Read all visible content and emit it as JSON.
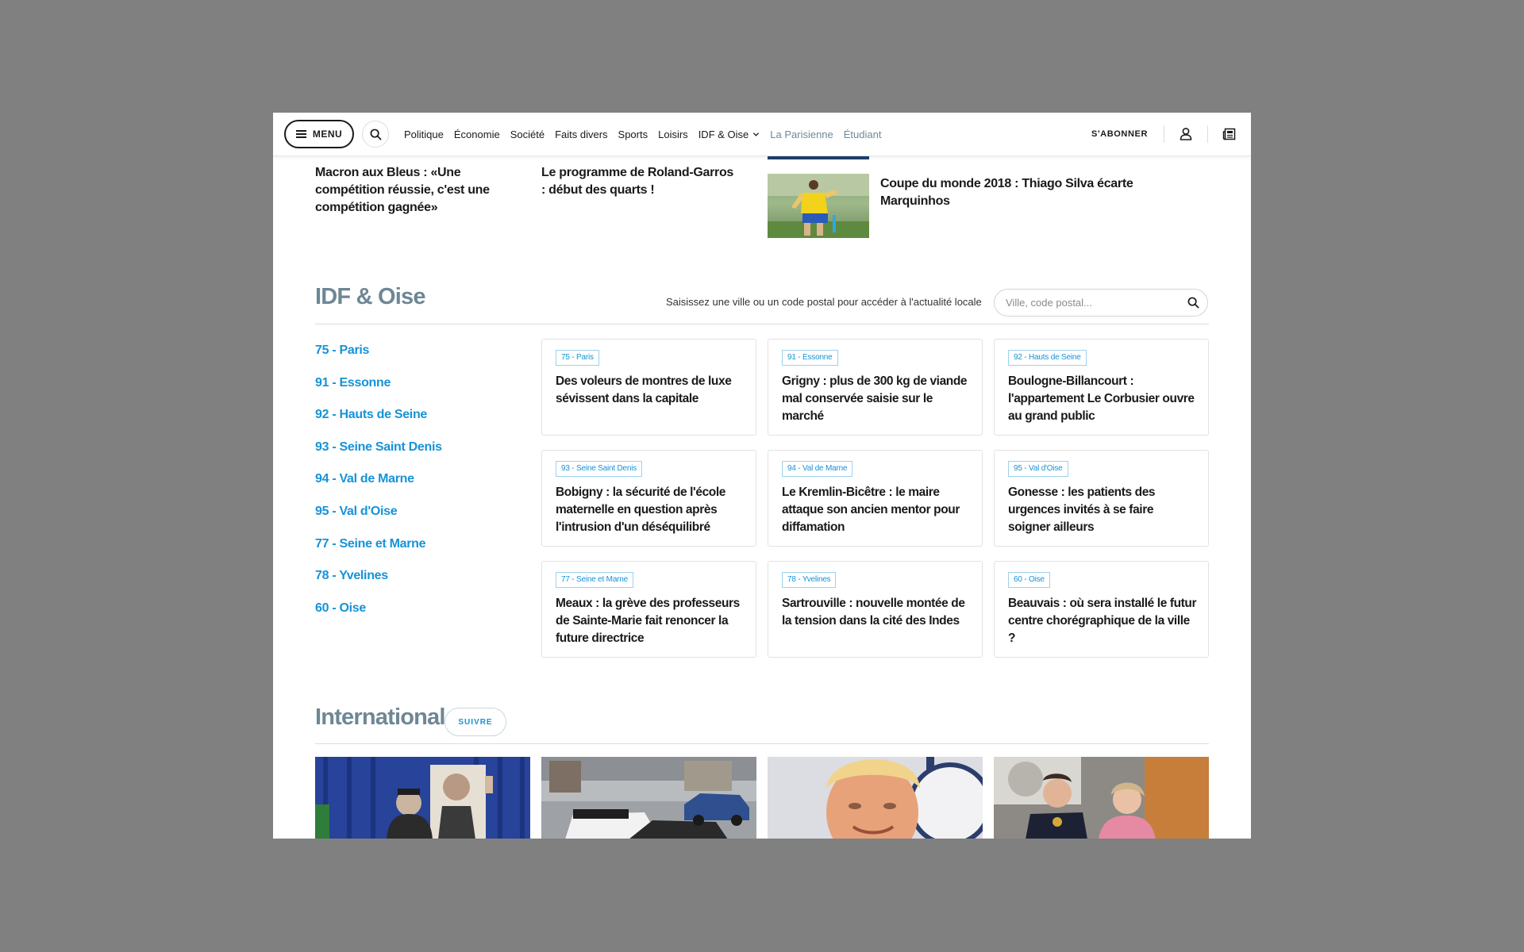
{
  "nav": {
    "menu_label": "MENU",
    "links": [
      "Politique",
      "Économie",
      "Société",
      "Faits divers",
      "Sports",
      "Loisirs",
      "IDF & Oise"
    ],
    "muted_links": [
      "La Parisienne",
      "Étudiant"
    ],
    "subscribe_label": "S'ABONNER"
  },
  "top_articles": [
    "Macron aux Bleus : «Une compétition réussie, c'est une compétition gagnée»",
    "Le programme de Roland-Garros : début des quarts !",
    "Coupe du monde 2018 : Thiago Silva écarte Marquinhos"
  ],
  "idf": {
    "title": "IDF & Oise",
    "hint": "Saisissez une ville ou un code postal pour accéder à l'actualité locale",
    "search_placeholder": "Ville, code postal...",
    "departments": [
      "75  - Paris",
      "91 - Essonne",
      "92 - Hauts de Seine",
      "93 - Seine Saint Denis",
      "94 - Val de Marne",
      "95 - Val d'Oise",
      "77 - Seine et Marne",
      "78 - Yvelines",
      "60 - Oise"
    ],
    "cards": [
      {
        "tag": "75 - Paris",
        "title": "Des voleurs de montres de luxe sévissent dans la capitale"
      },
      {
        "tag": "91 - Essonne",
        "title": "Grigny : plus de 300 kg de viande mal conservée saisie sur le marché"
      },
      {
        "tag": "92 - Hauts de Seine",
        "title": "Boulogne-Billancourt : l'appartement Le Corbusier ouvre au grand public"
      },
      {
        "tag": "93 - Seine Saint Denis",
        "title": "Bobigny : la sécurité de l'école maternelle en question après l'intrusion d'un déséquilibré"
      },
      {
        "tag": "94 - Val de Marne",
        "title": "Le Kremlin-Bicêtre : le maire attaque son ancien mentor pour diffamation"
      },
      {
        "tag": "95 - Val d'Oise",
        "title": "Gonesse : les patients des urgences invités à se faire soigner ailleurs"
      },
      {
        "tag": "77 - Seine et Marne",
        "title": "Meaux : la grève des professeurs de Sainte-Marie fait renoncer la future directrice"
      },
      {
        "tag": "78 - Yvelines",
        "title": "Sartrouville : nouvelle montée de la tension dans la cité des Indes"
      },
      {
        "tag": "60 - Oise",
        "title": "Beauvais : où sera installé le futur centre chorégraphique de la ville ?"
      }
    ]
  },
  "international": {
    "title": "International",
    "follow_label": "SUIVRE"
  },
  "colors": {
    "accent": "#1593d8",
    "section_title": "#6e8794",
    "muted_nav": "#6e8a99",
    "backdrop": "#808080"
  }
}
